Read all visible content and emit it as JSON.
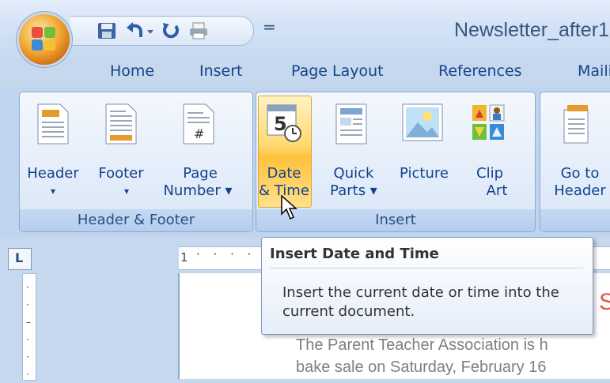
{
  "window": {
    "doc_title": "Newsletter_after1"
  },
  "quick_access": {
    "items": [
      "save-icon",
      "undo-icon",
      "redo-icon",
      "print-icon"
    ],
    "more": "="
  },
  "tabs": [
    "Home",
    "Insert",
    "Page Layout",
    "References",
    "Maili"
  ],
  "ribbon": {
    "header_footer": {
      "label": "Header & Footer",
      "buttons": [
        {
          "line1": "Header",
          "line2": "▾"
        },
        {
          "line1": "Footer",
          "line2": "▾"
        },
        {
          "line1": "Page",
          "line2": "Number ▾"
        }
      ]
    },
    "insert": {
      "label": "Insert",
      "buttons": [
        {
          "line1": "Date",
          "line2": "& Time"
        },
        {
          "line1": "Quick",
          "line2": "Parts ▾"
        },
        {
          "line1": "Picture",
          "line2": ""
        },
        {
          "line1": "Clip",
          "line2": "Art"
        }
      ]
    },
    "navigation": {
      "buttons": [
        {
          "line1": "Go to",
          "line2": "Header"
        }
      ]
    }
  },
  "tooltip": {
    "title": "Insert Date and Time",
    "description": "Insert the current date or time into the current document."
  },
  "document": {
    "line1": "The Parent Teacher Association is h",
    "line2": "bake sale on Saturday, February 16",
    "heading_fragment": "S"
  },
  "ruler": {
    "marker": "1",
    "corner": "L"
  }
}
